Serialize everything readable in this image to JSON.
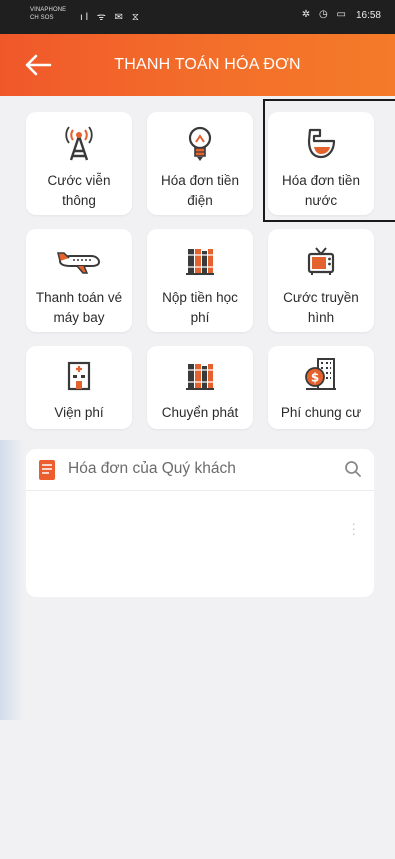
{
  "status_bar": {
    "carrier_line1": "VINAPHONE",
    "carrier_line2": "CH SOS",
    "left_icons": "ıl ᯤ ✉ ⧖",
    "right_icons": "✲ ◷ ▭",
    "time": "16:58"
  },
  "header": {
    "title": "THANH TOÁN HÓA ĐƠN",
    "back_icon": "arrow-left-icon",
    "background": "#f36d2a"
  },
  "services": [
    {
      "label": "Cước viễn thông",
      "icon": "antenna-icon"
    },
    {
      "label": "Hóa đơn tiền điện",
      "icon": "lightbulb-icon"
    },
    {
      "label": "Hóa đơn tiền nước",
      "icon": "water-tap-icon"
    },
    {
      "label": "Thanh toán vé máy bay",
      "icon": "airplane-icon"
    },
    {
      "label": "Nộp tiền học phí",
      "icon": "books-icon"
    },
    {
      "label": "Cước truyền hình",
      "icon": "tv-icon"
    },
    {
      "label": "Viện phí",
      "icon": "hospital-icon"
    },
    {
      "label": "Chuyển phát",
      "icon": "books-icon"
    },
    {
      "label": "Phí chung cư",
      "icon": "apartment-icon"
    }
  ],
  "bill_section": {
    "title": "Hóa đơn của Quý khách",
    "doc_icon": "document-icon",
    "search_icon": "search-icon"
  },
  "colors": {
    "accent": "#f36d2a",
    "icon_orange": "#e4622d",
    "icon_dark": "#3a3a3a"
  }
}
